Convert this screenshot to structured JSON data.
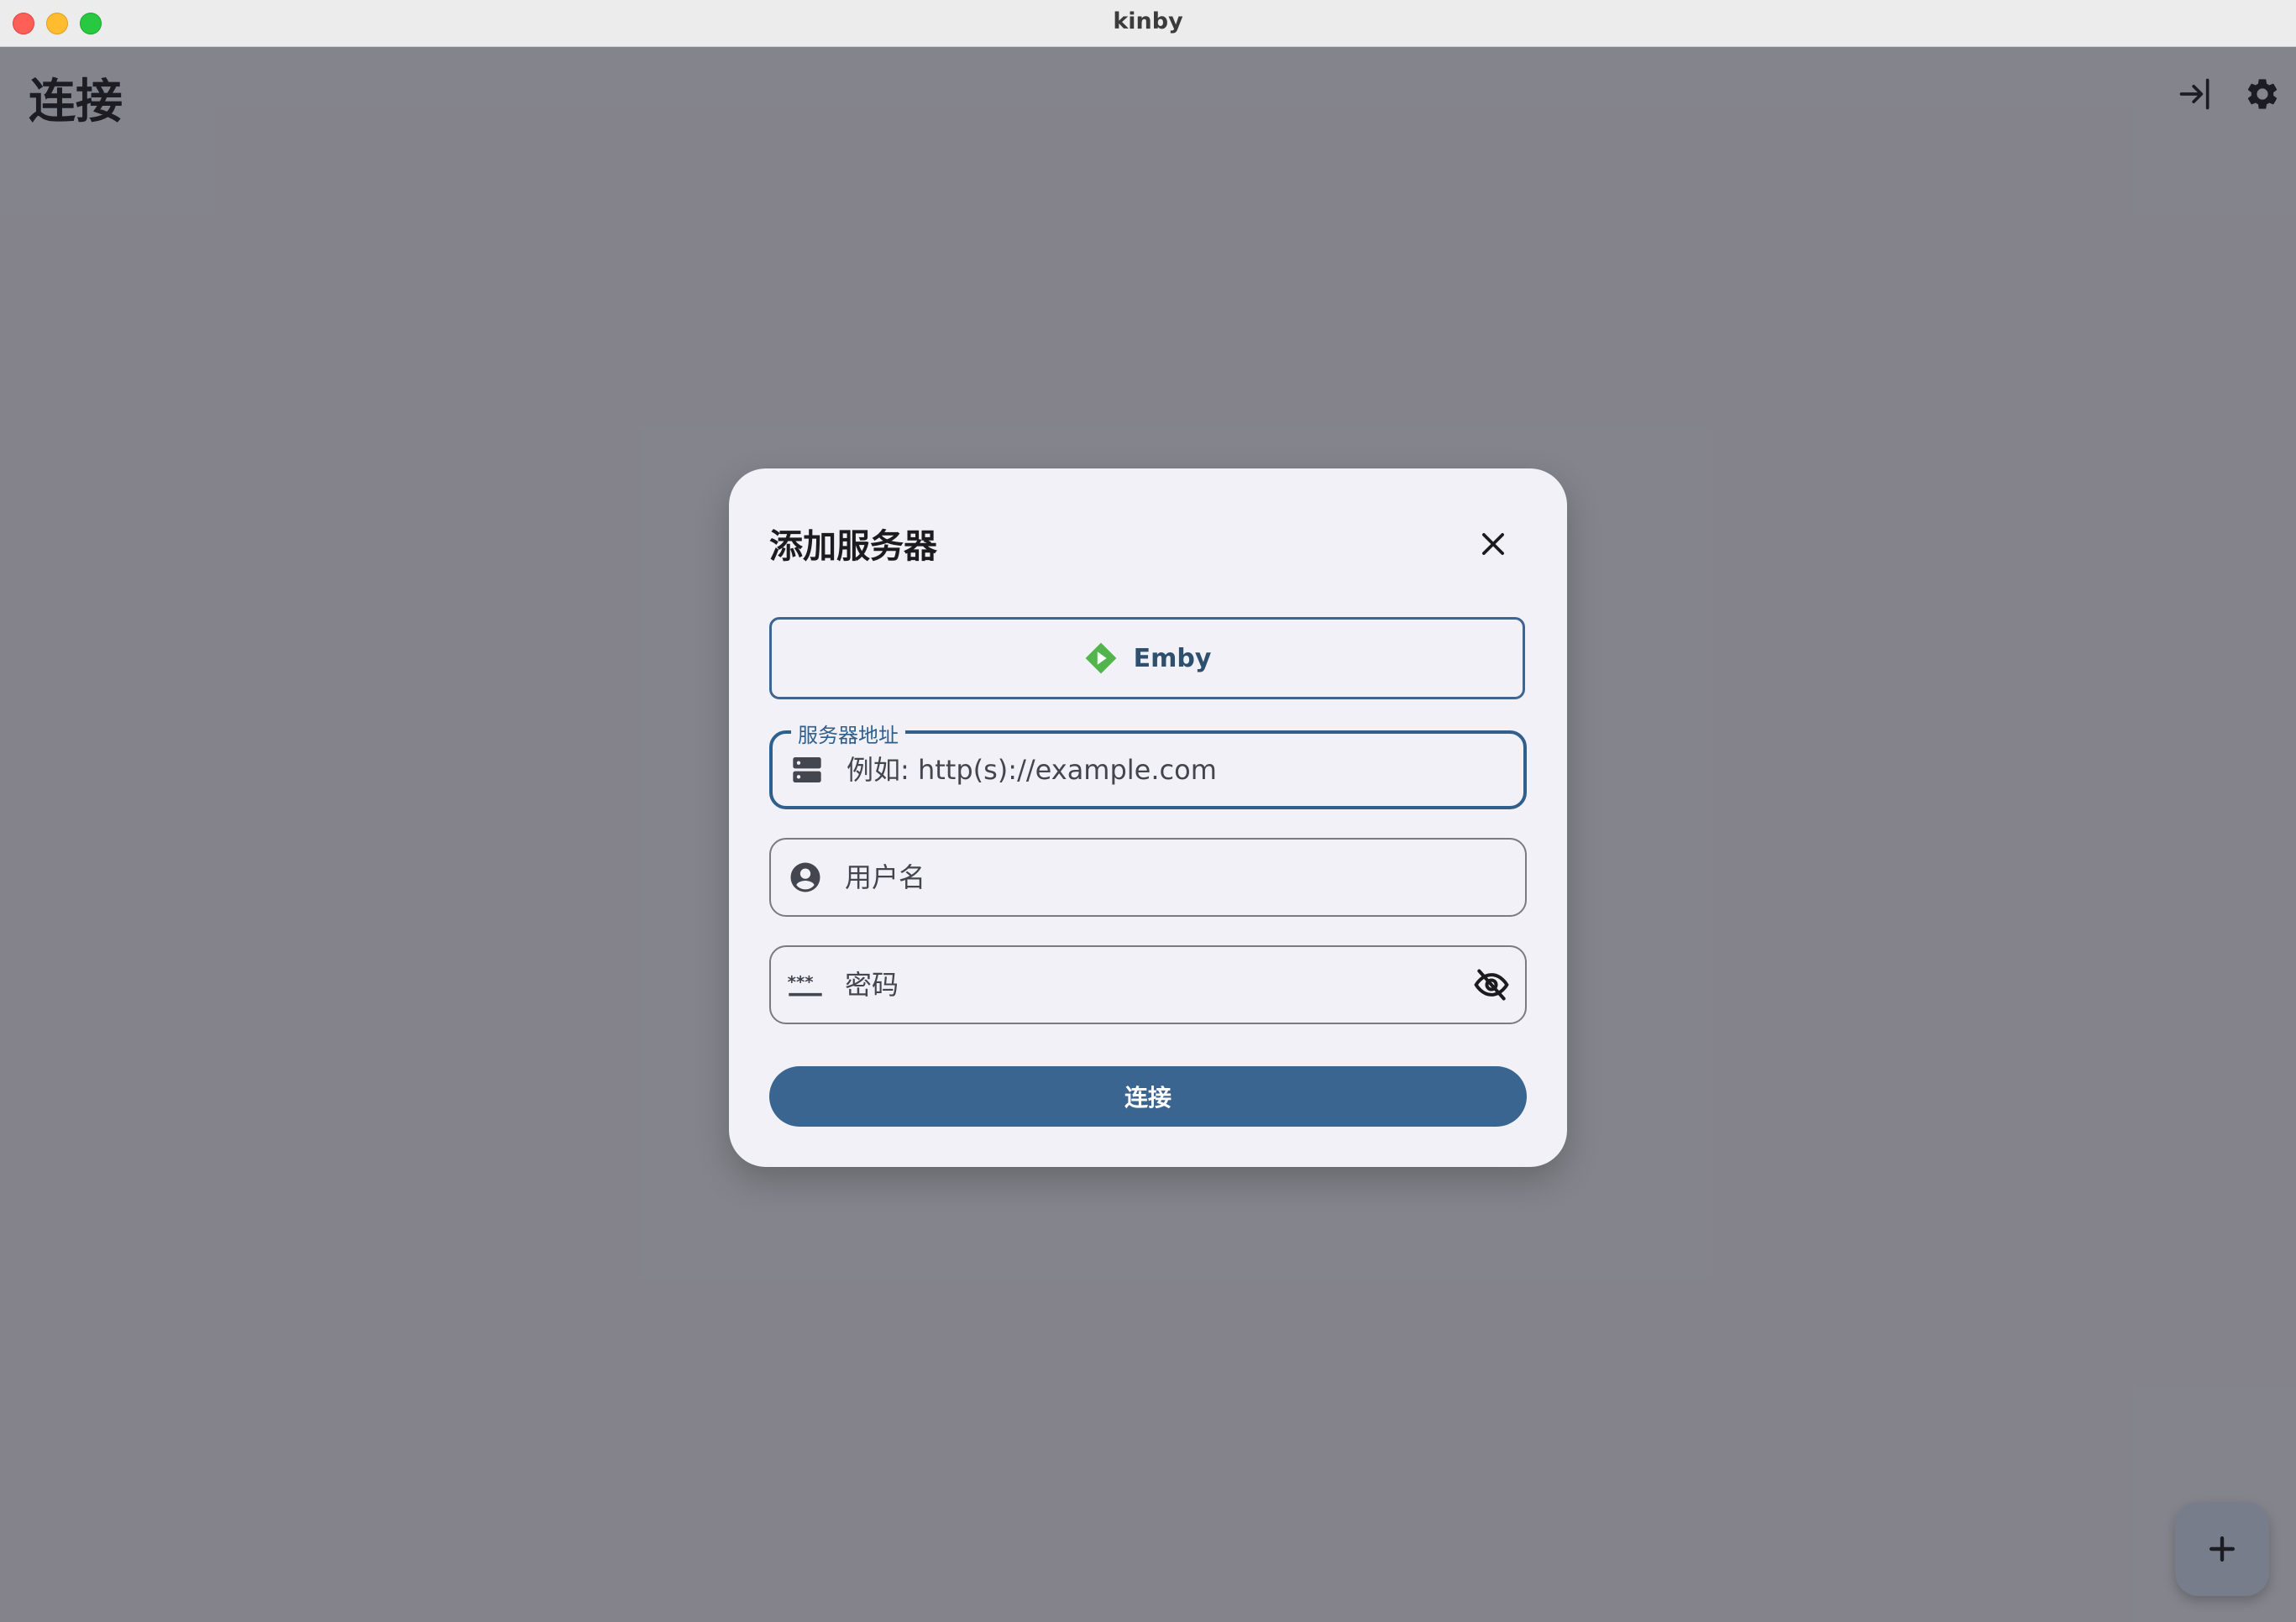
{
  "window": {
    "title": "kinby"
  },
  "page": {
    "title": "连接"
  },
  "toolbar": {
    "login_icon": "login-icon",
    "settings_icon": "gear-icon"
  },
  "fab": {
    "label": "+",
    "icon": "plus-icon"
  },
  "dialog": {
    "title": "添加服务器",
    "close_icon": "close-icon",
    "server_type": {
      "label": "Emby",
      "icon": "emby-logo-icon",
      "accent": "#52b54b"
    },
    "server_address": {
      "label": "服务器地址",
      "placeholder": "例如: http(s)://example.com",
      "value": ""
    },
    "username": {
      "placeholder": "用户名",
      "value": ""
    },
    "password": {
      "placeholder": "密码",
      "value": ""
    },
    "connect_label": "连接"
  },
  "colors": {
    "primary": "#3a6591",
    "surface": "#f2f1f8",
    "scrim": "#8a898f",
    "fab": "#d7e3f6"
  }
}
